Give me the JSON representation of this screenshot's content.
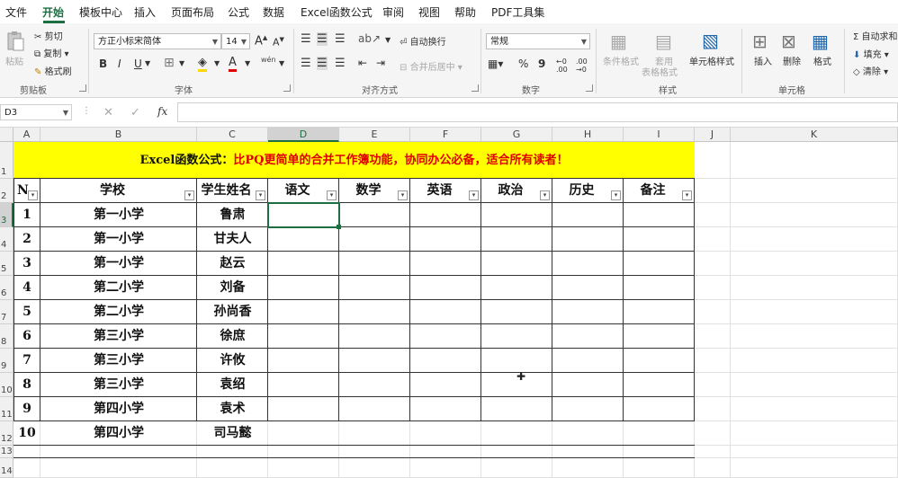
{
  "menu": {
    "items": [
      "文件",
      "开始",
      "模板中心",
      "插入",
      "页面布局",
      "公式",
      "数据",
      "Excel函数公式",
      "审阅",
      "视图",
      "帮助",
      "PDF工具集"
    ],
    "active": "开始"
  },
  "ribbon": {
    "clipboard": {
      "label": "剪贴板",
      "paste": "粘贴",
      "cut": "剪切",
      "copy": "复制",
      "format_painter": "格式刷"
    },
    "font": {
      "label": "字体",
      "font_name": "方正小标宋简体",
      "font_size": "14",
      "bold": "B",
      "italic": "I",
      "underline": "U",
      "grow": "A",
      "shrink": "A",
      "font_color_glyph": "A",
      "phonetic": "wén"
    },
    "alignment": {
      "label": "对齐方式",
      "wrap": "自动换行",
      "merge": "合并后居中"
    },
    "number": {
      "label": "数字",
      "format": "常规",
      "percent": "%",
      "comma": "9",
      "inc_dec": ".00→.0",
      "dec_dec": ".00→.0"
    },
    "styles": {
      "label": "样式",
      "conditional": "条件格式",
      "table_format_1": "套用",
      "table_format_2": "表格格式",
      "cell_styles": "单元格样式"
    },
    "cells": {
      "label": "单元格",
      "insert": "插入",
      "delete": "删除",
      "format": "格式"
    },
    "editing": {
      "autosum": "自动求和",
      "fill": "填充",
      "clear": "清除"
    }
  },
  "formula_bar": {
    "name_box": "D3",
    "fx": "fx",
    "cancel": "✕",
    "enter": "✓",
    "formula": ""
  },
  "sheet": {
    "columns": [
      "A",
      "B",
      "C",
      "D",
      "E",
      "F",
      "G",
      "H",
      "I",
      "J",
      "K"
    ],
    "selected_col": "D",
    "rows": [
      "1",
      "2",
      "3",
      "4",
      "5",
      "6",
      "7",
      "8",
      "9",
      "10",
      "11",
      "12",
      "13",
      "14"
    ],
    "selected_row": "3",
    "title_prefix": "Excel函数公式：",
    "title_main": "比PQ更简单的合并工作簿功能，协同办公必备，适合所有读者！",
    "headers": [
      "N",
      "学校",
      "学生姓名",
      "语文",
      "数学",
      "英语",
      "政治",
      "历史",
      "备注"
    ],
    "data": [
      [
        "1",
        "第一小学",
        "鲁肃"
      ],
      [
        "2",
        "第一小学",
        "甘夫人"
      ],
      [
        "3",
        "第一小学",
        "赵云"
      ],
      [
        "4",
        "第二小学",
        "刘备"
      ],
      [
        "5",
        "第二小学",
        "孙尚香"
      ],
      [
        "6",
        "第三小学",
        "徐庶"
      ],
      [
        "7",
        "第三小学",
        "许攸"
      ],
      [
        "8",
        "第三小学",
        "袁绍"
      ],
      [
        "9",
        "第四小学",
        "袁术"
      ],
      [
        "10",
        "第四小学",
        "司马懿"
      ]
    ]
  },
  "colors": {
    "accent": "#1e6e42",
    "title_bg": "#ffff00",
    "title_red": "#e00000"
  }
}
